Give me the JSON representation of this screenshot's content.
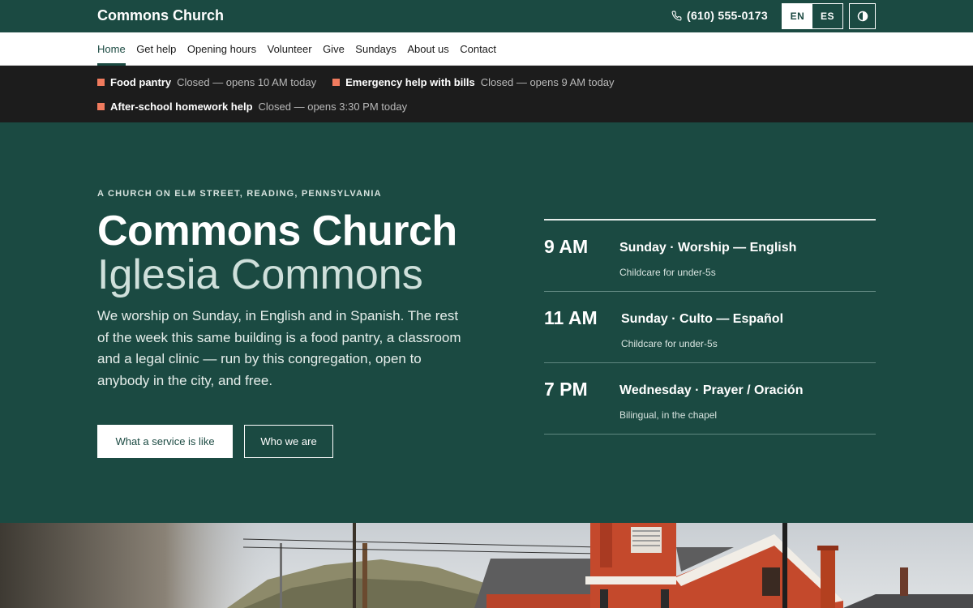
{
  "header": {
    "brand": "Commons Church",
    "phone": "(610) 555-0173",
    "lang_en": "EN",
    "lang_es": "ES"
  },
  "nav": {
    "items": [
      "Home",
      "Get help",
      "Opening hours",
      "Volunteer",
      "Give",
      "Sundays",
      "About us",
      "Contact"
    ]
  },
  "status": {
    "items": [
      {
        "name": "Food pantry",
        "text": "Closed — opens 10 AM today"
      },
      {
        "name": "Emergency help with bills",
        "text": "Closed — opens 9 AM today"
      },
      {
        "name": "After-school homework help",
        "text": "Closed — opens 3:30 PM today"
      }
    ]
  },
  "hero": {
    "eyebrow": "A CHURCH ON ELM STREET, READING, PENNSYLVANIA",
    "title": "Commons Church",
    "title_es": "Iglesia Commons",
    "lead": "We worship on Sunday, in English and in Spanish. The rest of the week this same building is a food pantry, a classroom and a legal clinic — run by this congregation, open to anybody in the city, and free.",
    "btn_primary": "What a service is like",
    "btn_secondary": "Who we are"
  },
  "schedule": [
    {
      "time": "9 AM",
      "title": "Sunday · Worship — English",
      "note": "Childcare for under-5s"
    },
    {
      "time": "11 AM",
      "title": "Sunday · Culto — Español",
      "note": "Childcare for under-5s"
    },
    {
      "time": "7 PM",
      "title": "Wednesday · Prayer / Oración",
      "note": "Bilingual, in the chapel"
    }
  ],
  "colors": {
    "brand_green": "#1b4a42",
    "status_dot": "#f07b5e",
    "status_bar": "#1c1c1c"
  }
}
